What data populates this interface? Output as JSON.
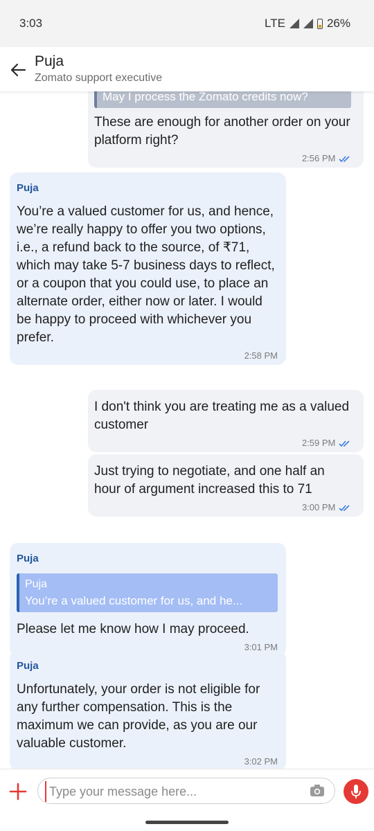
{
  "status": {
    "time": "3:03",
    "network": "LTE",
    "battery": "26%"
  },
  "header": {
    "name": "Puja",
    "subtitle": "Zomato support executive"
  },
  "messages": [
    {
      "type": "out",
      "quote": "May I process the Zomato credits now?",
      "text": "These are enough for another order on your platform right?",
      "time": "2:56 PM"
    },
    {
      "type": "in",
      "sender": "Puja",
      "text": "You’re a valued customer for us, and hence, we’re really happy to offer you two options, i.e., a refund back to the source, of ₹71, which may take 5-7 business days to reflect, or a coupon that you could use, to place an alternate order, either now or later. I would be happy to proceed with whichever you prefer.",
      "time": "2:58 PM"
    },
    {
      "type": "out",
      "text": "I don't think you are treating me as a valued customer",
      "time": "2:59 PM"
    },
    {
      "type": "out",
      "text": "Just trying to negotiate, and one half an hour of argument increased this to 71",
      "time": "3:00 PM"
    },
    {
      "type": "in",
      "sender": "Puja",
      "quote_name": "Puja",
      "quote": "You’re a valued customer for us, and he...",
      "text": "Please let me know how I may proceed.",
      "time": "3:01 PM"
    },
    {
      "type": "in",
      "sender": "Puja",
      "text": "Unfortunately, your order is not eligible for any further compensation. This is the maximum we can provide, as you are our valuable customer.",
      "time": "3:02 PM"
    }
  ],
  "composer": {
    "placeholder": "Type your message here..."
  },
  "colors": {
    "accent": "#e53935",
    "sender": "#22569c",
    "incoming_bg": "#ebf1fb",
    "outgoing_bg": "#f1f2f6",
    "read_ticks": "#3b7be0"
  },
  "icons": [
    "back-arrow-icon",
    "plus-icon",
    "camera-icon",
    "mic-icon",
    "double-check-icon"
  ]
}
